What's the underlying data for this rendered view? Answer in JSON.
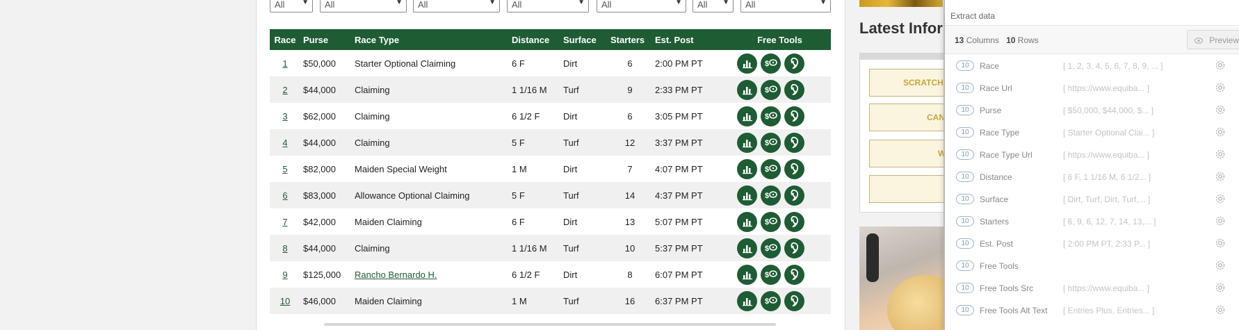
{
  "filters": [
    "All",
    "All",
    "All",
    "All",
    "All",
    "All",
    "All"
  ],
  "table": {
    "headers": [
      "Race",
      "Purse",
      "Race Type",
      "Distance",
      "Surface",
      "Starters",
      "Est. Post",
      "Free Tools"
    ],
    "rows": [
      {
        "race": "1",
        "purse": "$50,000",
        "type": "Starter Optional Claiming",
        "distance": "6 F",
        "surface": "Dirt",
        "starters": "6",
        "post": "2:00 PM PT"
      },
      {
        "race": "2",
        "purse": "$44,000",
        "type": "Claiming",
        "distance": "1 1/16 M",
        "surface": "Turf",
        "starters": "9",
        "post": "2:33 PM PT"
      },
      {
        "race": "3",
        "purse": "$62,000",
        "type": "Claiming",
        "distance": "6 1/2 F",
        "surface": "Dirt",
        "starters": "6",
        "post": "3:05 PM PT"
      },
      {
        "race": "4",
        "purse": "$44,000",
        "type": "Claiming",
        "distance": "5 F",
        "surface": "Turf",
        "starters": "12",
        "post": "3:37 PM PT"
      },
      {
        "race": "5",
        "purse": "$82,000",
        "type": "Maiden Special Weight",
        "distance": "1 M",
        "surface": "Dirt",
        "starters": "7",
        "post": "4:07 PM PT"
      },
      {
        "race": "6",
        "purse": "$83,000",
        "type": "Allowance Optional Claiming",
        "distance": "5 F",
        "surface": "Turf",
        "starters": "14",
        "post": "4:37 PM PT"
      },
      {
        "race": "7",
        "purse": "$42,000",
        "type": "Maiden Claiming",
        "distance": "6 F",
        "surface": "Dirt",
        "starters": "13",
        "post": "5:07 PM PT"
      },
      {
        "race": "8",
        "purse": "$44,000",
        "type": "Claiming",
        "distance": "1 1/16 M",
        "surface": "Turf",
        "starters": "10",
        "post": "5:37 PM PT"
      },
      {
        "race": "9",
        "purse": "$125,000",
        "type": "Rancho Bernardo H.",
        "distance": "6 1/2 F",
        "surface": "Dirt",
        "starters": "8",
        "post": "6:07 PM PT"
      },
      {
        "race": "10",
        "purse": "$46,000",
        "type": "Maiden Claiming",
        "distance": "1 M",
        "surface": "Turf",
        "starters": "16",
        "post": "6:37 PM PT"
      }
    ],
    "tool_icons": [
      "chart-icon",
      "dollar-chat-icon",
      "horse-head-icon"
    ]
  },
  "sidebar": {
    "heading": "Latest Infor",
    "buttons": [
      "SCRATCH",
      "CAN",
      "W",
      ""
    ]
  },
  "extract_panel": {
    "title": "Extract data",
    "columns_count": "13",
    "columns_label": "Columns",
    "rows_count": "10",
    "rows_label": "Rows",
    "preview_label": "Preview",
    "columns": [
      {
        "count": "10",
        "name": "Race",
        "preview": "[ 1, 2, 3, 4, 5, 6, 7, 8, 9, ... ]"
      },
      {
        "count": "10",
        "name": "Race Url",
        "preview": "[ https://www.equiba... ]"
      },
      {
        "count": "10",
        "name": "Purse",
        "preview": "[ $50,000, $44,000, $... ]"
      },
      {
        "count": "10",
        "name": "Race Type",
        "preview": "[ Starter Optional Clai... ]"
      },
      {
        "count": "10",
        "name": "Race Type Url",
        "preview": "[ https://www.equiba... ]"
      },
      {
        "count": "10",
        "name": "Distance",
        "preview": "[ 6 F, 1 1/16 M, 6 1/2... ]"
      },
      {
        "count": "10",
        "name": "Surface",
        "preview": "[ Dirt, Turf, Dirt, Turf,... ]"
      },
      {
        "count": "10",
        "name": "Starters",
        "preview": "[ 6, 9, 6, 12, 7, 14, 13,... ]"
      },
      {
        "count": "10",
        "name": "Est. Post",
        "preview": "[ 2:00 PM PT, 2:33 P... ]"
      },
      {
        "count": "10",
        "name": "Free Tools",
        "preview": ""
      },
      {
        "count": "10",
        "name": "Free Tools Src",
        "preview": "[ https://www.equiba... ]"
      },
      {
        "count": "10",
        "name": "Free Tools Alt Text",
        "preview": "[ Entries Plus, Entries... ]"
      }
    ]
  }
}
